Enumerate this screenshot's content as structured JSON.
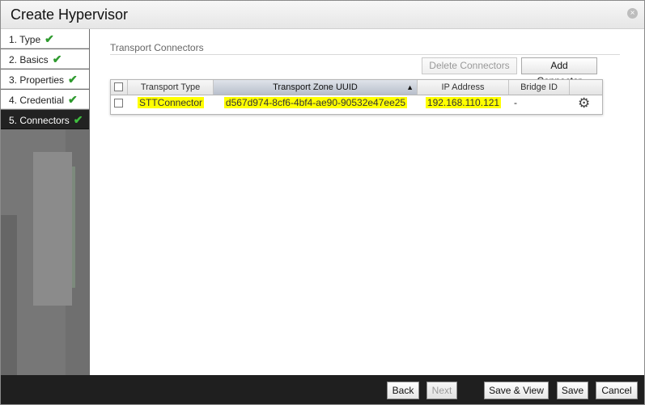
{
  "dialog": {
    "title": "Create Hypervisor",
    "close_icon": "×"
  },
  "steps": [
    {
      "label": "1. Type",
      "check": "✔"
    },
    {
      "label": "2. Basics",
      "check": "✔"
    },
    {
      "label": "3. Properties",
      "check": "✔"
    },
    {
      "label": "4. Credential",
      "check": "✔"
    },
    {
      "label": "5. Connectors",
      "check": "✔",
      "active": true
    }
  ],
  "section": {
    "title": "Transport Connectors"
  },
  "toolbar": {
    "delete_label": "Delete Connectors",
    "add_label": "Add Connector"
  },
  "table": {
    "columns": [
      "Transport Type",
      "Transport Zone UUID",
      "IP Address",
      "Bridge ID"
    ],
    "sort_arrow": "▲",
    "rows": [
      {
        "transport_type": "STTConnector",
        "zone_uuid": "d567d974-8cf6-4bf4-ae90-90532e47ee25",
        "ip_address": "192.168.110.121",
        "bridge_id": "-",
        "actions_icon": "gear-icon"
      }
    ]
  },
  "footer": {
    "back_label": "Back",
    "next_label": "Next",
    "save_view_label": "Save & View",
    "save_label": "Save",
    "cancel_label": "Cancel"
  },
  "colors": {
    "highlight": "#ffff00",
    "check_green": "#2e9a2e",
    "active_step_bg": "#222222"
  }
}
